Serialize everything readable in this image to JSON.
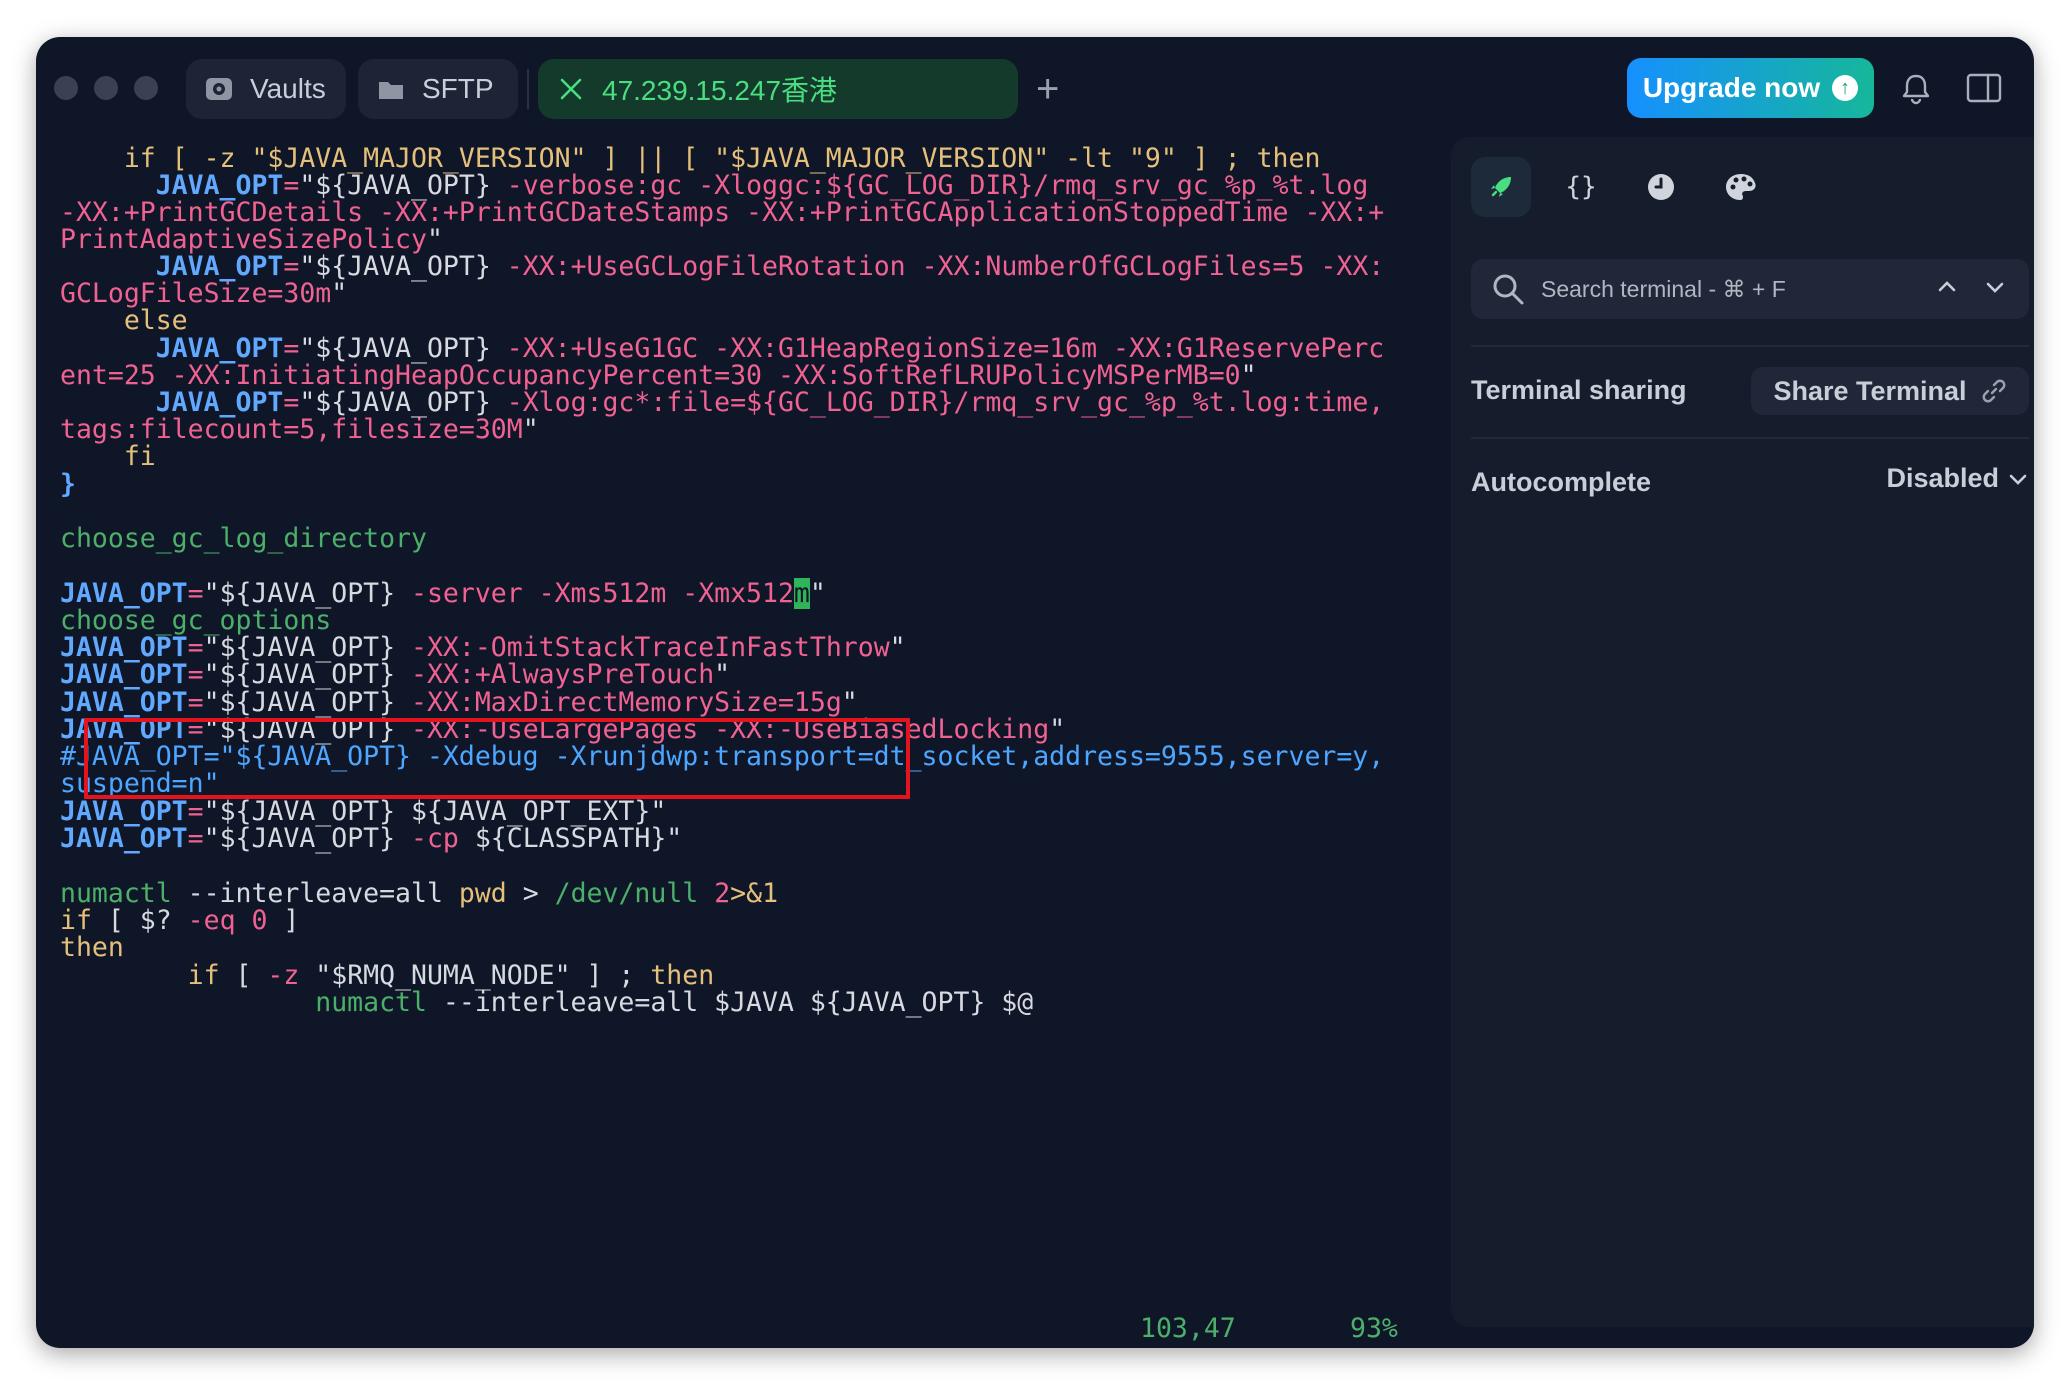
{
  "titlebar": {
    "tabs": [
      {
        "label": "Vaults",
        "icon": "vault-icon"
      },
      {
        "label": "SFTP",
        "icon": "folder-icon"
      },
      {
        "label": "47.239.15.247香港",
        "icon": "close-icon",
        "active": true
      }
    ],
    "upgrade_label": "Upgrade now"
  },
  "terminal": {
    "lines": [
      [
        {
          "c": "kw",
          "t": "    if [ -z \"$JAVA_MAJOR_VERSION\" ] || [ \"$JAVA_MAJOR_VERSION\" -lt \"9\" ] ; then"
        }
      ],
      [
        {
          "c": "key",
          "t": "      JAVA_OPT"
        },
        {
          "c": "opt",
          "t": "="
        },
        {
          "c": "str",
          "t": "\"${JAVA_OPT}"
        },
        {
          "c": "opt",
          "t": " -verbose:gc -Xloggc:${GC_LOG_DIR}/rmq_srv_gc_%p_%t.log"
        }
      ],
      [
        {
          "c": "opt",
          "t": "-XX:+PrintGCDetails -XX:+PrintGCDateStamps -XX:+PrintGCApplicationStoppedTime -XX:+"
        }
      ],
      [
        {
          "c": "opt",
          "t": "PrintAdaptiveSizePolicy"
        },
        {
          "c": "str",
          "t": "\""
        }
      ],
      [
        {
          "c": "key",
          "t": "      JAVA_OPT"
        },
        {
          "c": "opt",
          "t": "="
        },
        {
          "c": "str",
          "t": "\"${JAVA_OPT}"
        },
        {
          "c": "opt",
          "t": " -XX:+UseGCLogFileRotation -XX:NumberOfGCLogFiles=5 -XX:"
        }
      ],
      [
        {
          "c": "opt",
          "t": "GCLogFileSize=30m"
        },
        {
          "c": "str",
          "t": "\""
        }
      ],
      [
        {
          "c": "kw",
          "t": "    else"
        }
      ],
      [
        {
          "c": "key",
          "t": "      JAVA_OPT"
        },
        {
          "c": "opt",
          "t": "="
        },
        {
          "c": "str",
          "t": "\"${JAVA_OPT}"
        },
        {
          "c": "opt",
          "t": " -XX:+UseG1GC -XX:G1HeapRegionSize=16m -XX:G1ReservePerc"
        }
      ],
      [
        {
          "c": "opt",
          "t": "ent=25 -XX:InitiatingHeapOccupancyPercent=30 -XX:SoftRefLRUPolicyMSPerMB=0"
        },
        {
          "c": "str",
          "t": "\""
        }
      ],
      [
        {
          "c": "key",
          "t": "      JAVA_OPT"
        },
        {
          "c": "opt",
          "t": "="
        },
        {
          "c": "str",
          "t": "\"${JAVA_OPT}"
        },
        {
          "c": "opt",
          "t": " -Xlog:gc*:file=${GC_LOG_DIR}/rmq_srv_gc_%p_%t.log:time,"
        }
      ],
      [
        {
          "c": "opt",
          "t": "tags:filecount=5,filesize=30M"
        },
        {
          "c": "str",
          "t": "\""
        }
      ],
      [
        {
          "c": "kw",
          "t": "    fi"
        }
      ],
      [
        {
          "c": "key",
          "t": "}"
        }
      ],
      [
        {
          "c": "str",
          "t": ""
        }
      ],
      [
        {
          "c": "grn",
          "t": "choose_gc_log_directory"
        }
      ],
      [
        {
          "c": "str",
          "t": ""
        }
      ],
      [
        {
          "c": "key",
          "t": "JAVA_OPT"
        },
        {
          "c": "opt",
          "t": "="
        },
        {
          "c": "str",
          "t": "\"${JAVA_OPT}"
        },
        {
          "c": "opt",
          "t": " -server -Xms512m -Xmx512"
        },
        {
          "c": "cursor",
          "t": "m"
        },
        {
          "c": "str",
          "t": "\""
        }
      ],
      [
        {
          "c": "grn",
          "t": "choose_gc_options"
        }
      ],
      [
        {
          "c": "key",
          "t": "JAVA_OPT"
        },
        {
          "c": "opt",
          "t": "="
        },
        {
          "c": "str",
          "t": "\"${JAVA_OPT}"
        },
        {
          "c": "opt",
          "t": " -XX:-OmitStackTraceInFastThrow"
        },
        {
          "c": "str",
          "t": "\""
        }
      ],
      [
        {
          "c": "key",
          "t": "JAVA_OPT"
        },
        {
          "c": "opt",
          "t": "="
        },
        {
          "c": "str",
          "t": "\"${JAVA_OPT}"
        },
        {
          "c": "opt",
          "t": " -XX:+AlwaysPreTouch"
        },
        {
          "c": "str",
          "t": "\""
        }
      ],
      [
        {
          "c": "key",
          "t": "JAVA_OPT"
        },
        {
          "c": "opt",
          "t": "="
        },
        {
          "c": "str",
          "t": "\"${JAVA_OPT}"
        },
        {
          "c": "opt",
          "t": " -XX:MaxDirectMemorySize=15g"
        },
        {
          "c": "str",
          "t": "\""
        }
      ],
      [
        {
          "c": "key",
          "t": "JAVA_OPT"
        },
        {
          "c": "opt",
          "t": "="
        },
        {
          "c": "str",
          "t": "\"${JAVA_OPT}"
        },
        {
          "c": "opt",
          "t": " -XX:-UseLargePages -XX:-UseBiasedLocking"
        },
        {
          "c": "str",
          "t": "\""
        }
      ],
      [
        {
          "c": "cmt",
          "t": "#JAVA_OPT=\"${JAVA_OPT} -Xdebug -Xrunjdwp:transport=dt_socket,address=9555,server=y,"
        }
      ],
      [
        {
          "c": "cmt",
          "t": "suspend=n\""
        }
      ],
      [
        {
          "c": "key",
          "t": "JAVA_OPT"
        },
        {
          "c": "opt",
          "t": "="
        },
        {
          "c": "str",
          "t": "\"${JAVA_OPT} ${JAVA_OPT_EXT}\""
        }
      ],
      [
        {
          "c": "key",
          "t": "JAVA_OPT"
        },
        {
          "c": "opt",
          "t": "="
        },
        {
          "c": "str",
          "t": "\"${JAVA_OPT}"
        },
        {
          "c": "opt",
          "t": " -cp"
        },
        {
          "c": "str",
          "t": " ${CLASSPATH}\""
        }
      ],
      [
        {
          "c": "str",
          "t": ""
        }
      ],
      [
        {
          "c": "grn",
          "t": "numactl"
        },
        {
          "c": "str",
          "t": " --interleave=all "
        },
        {
          "c": "kw",
          "t": "pwd"
        },
        {
          "c": "str",
          "t": " > "
        },
        {
          "c": "grn",
          "t": "/dev/null"
        },
        {
          "c": "str",
          "t": " "
        },
        {
          "c": "opt",
          "t": "2"
        },
        {
          "c": "kw",
          "t": ">&1"
        }
      ],
      [
        {
          "c": "kw",
          "t": "if"
        },
        {
          "c": "str",
          "t": " [ $? "
        },
        {
          "c": "opt",
          "t": "-eq"
        },
        {
          "c": "str",
          "t": " "
        },
        {
          "c": "opt",
          "t": "0"
        },
        {
          "c": "str",
          "t": " ]"
        }
      ],
      [
        {
          "c": "kw",
          "t": "then"
        }
      ],
      [
        {
          "c": "kw",
          "t": "        if"
        },
        {
          "c": "str",
          "t": " [ "
        },
        {
          "c": "opt",
          "t": "-z"
        },
        {
          "c": "str",
          "t": " \"$RMQ_NUMA_NODE\" ] ; "
        },
        {
          "c": "kw",
          "t": "then"
        }
      ],
      [
        {
          "c": "grn",
          "t": "                numactl"
        },
        {
          "c": "str",
          "t": " --interleave=all $JAVA ${JAVA_OPT} $@"
        }
      ]
    ],
    "status_position": "103,47",
    "status_percent": "93%"
  },
  "sidebar": {
    "tabs": [
      "rocket-icon",
      "braces-icon",
      "clock-icon",
      "palette-icon"
    ],
    "search_placeholder": "Search terminal - ⌘ + F",
    "sharing_label": "Terminal sharing",
    "share_button_label": "Share Terminal",
    "autocomplete_label": "Autocomplete",
    "autocomplete_value": "Disabled"
  },
  "colors": {
    "background": "#0f1628",
    "accent_green": "#4ade80",
    "highlight_red": "#e4141e",
    "upgrade_gradient_start": "#1690ff",
    "upgrade_gradient_end": "#16b79a"
  }
}
